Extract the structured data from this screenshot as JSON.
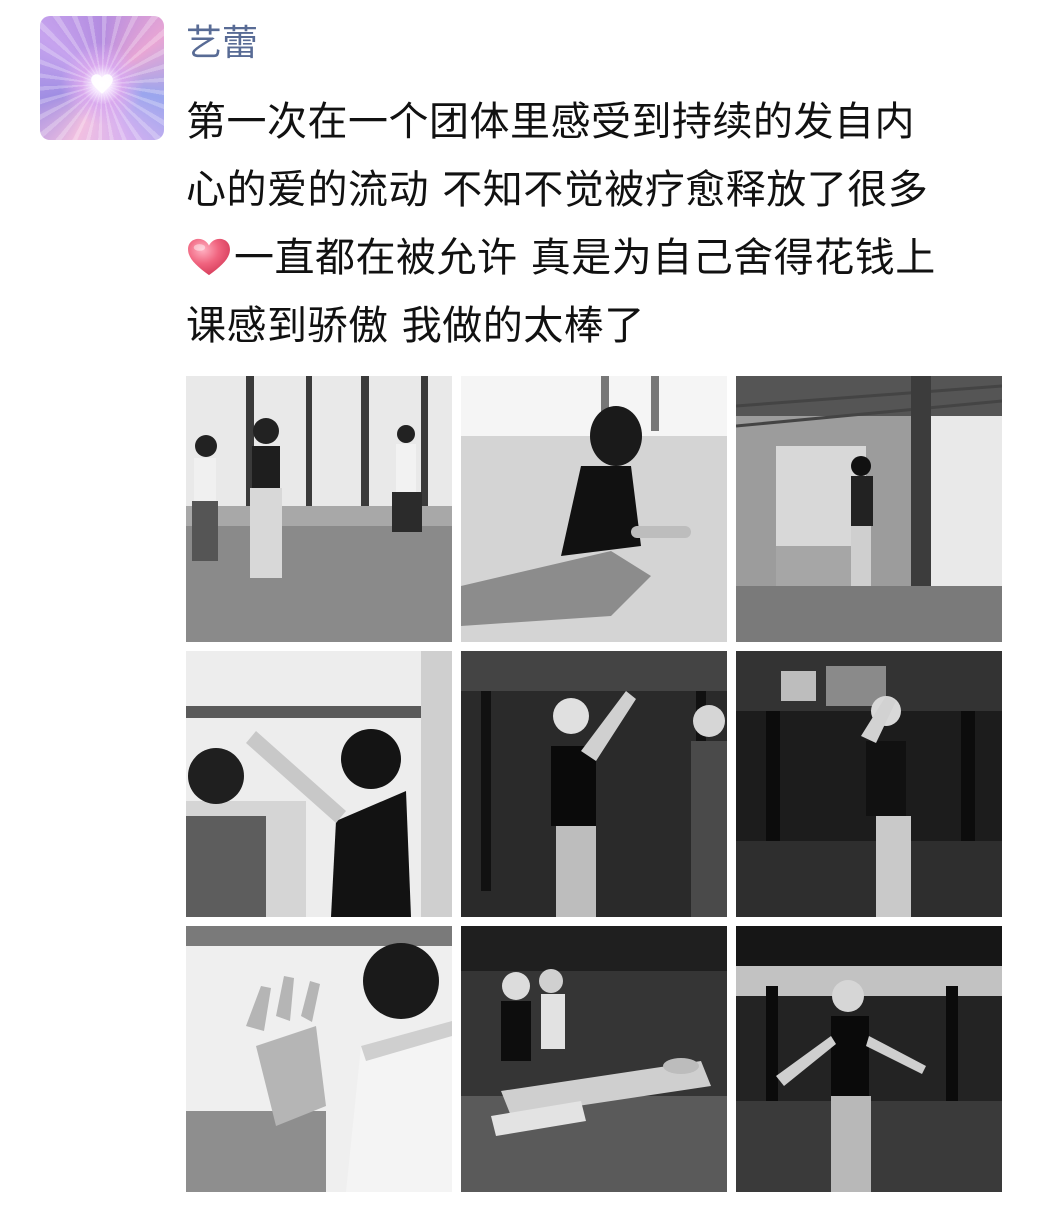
{
  "post": {
    "username": "艺蕾",
    "text_lines": [
      "第一次在一个团体里感受到持续的发自内",
      "心的爱的流动 不知不觉被疗愈释放了很多",
      "一直都在被允许 真是为自己舍得花钱上",
      "课感到骄傲 我做的太棒了"
    ],
    "inline_emoji": "heart-emoji",
    "photos": [
      {
        "name": "photo-1",
        "tone": "light"
      },
      {
        "name": "photo-2",
        "tone": "light"
      },
      {
        "name": "photo-3",
        "tone": "light"
      },
      {
        "name": "photo-4",
        "tone": "light"
      },
      {
        "name": "photo-5",
        "tone": "dark"
      },
      {
        "name": "photo-6",
        "tone": "dark"
      },
      {
        "name": "photo-7",
        "tone": "light"
      },
      {
        "name": "photo-8",
        "tone": "dark"
      },
      {
        "name": "photo-9",
        "tone": "dark"
      }
    ]
  },
  "colors": {
    "username": "#586b95",
    "text": "#111111",
    "heart": "#e8506e",
    "background": "#ffffff"
  }
}
